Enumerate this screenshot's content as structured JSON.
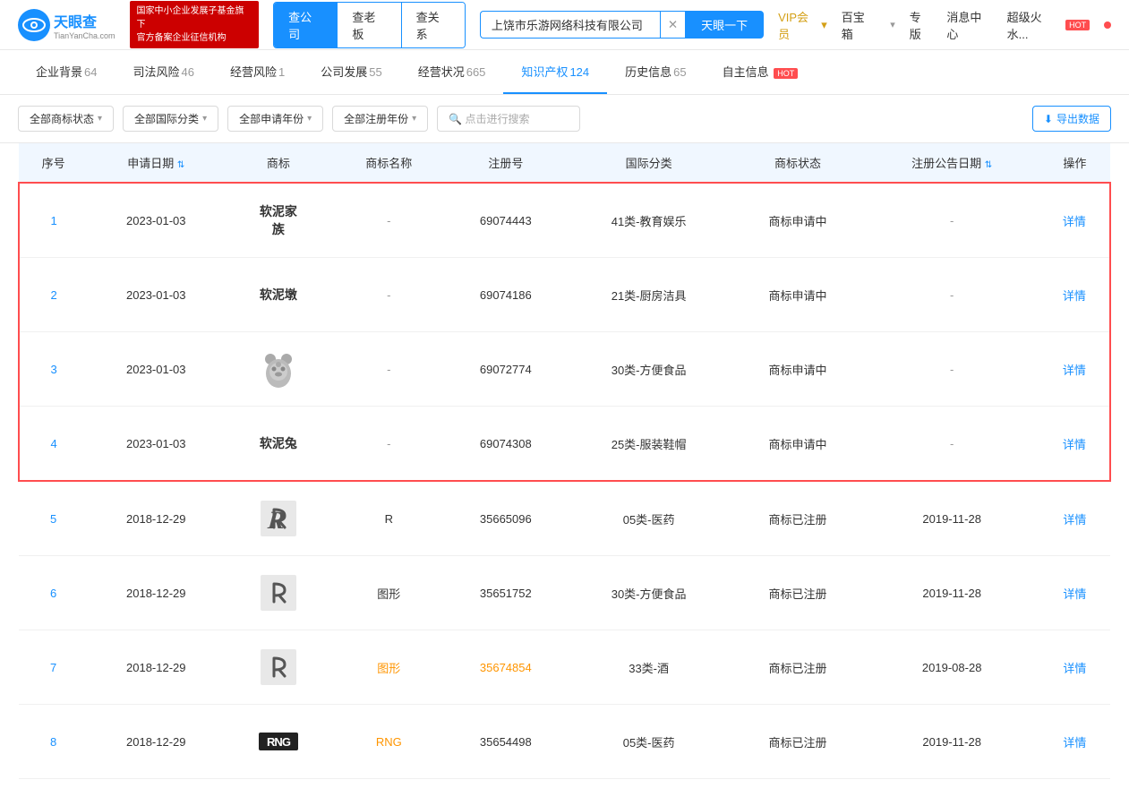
{
  "header": {
    "logo_text": "天眼查",
    "logo_sub": "TianYanCha.com",
    "official_badge": "国家中小企业发展子基金旗下\n官方备案企业征信机构",
    "tabs": [
      {
        "label": "查公司",
        "active": true
      },
      {
        "label": "查老板",
        "active": false
      },
      {
        "label": "查关系",
        "active": false
      }
    ],
    "search_value": "上饶市乐游网络科技有限公司",
    "search_btn": "天眼一下",
    "vip_label": "VIP会员",
    "baibao": "百宝箱",
    "pro": "专版",
    "msg": "消息中心",
    "hot_label": "超级火水...",
    "hot_badge": "HOT"
  },
  "nav": {
    "tabs": [
      {
        "label": "企业背景",
        "count": "64",
        "active": false
      },
      {
        "label": "司法风险",
        "count": "46",
        "active": false
      },
      {
        "label": "经营风险",
        "count": "1",
        "active": false
      },
      {
        "label": "公司发展",
        "count": "55",
        "active": false
      },
      {
        "label": "经营状况",
        "count": "665",
        "active": false
      },
      {
        "label": "知识产权",
        "count": "124",
        "active": true
      },
      {
        "label": "历史信息",
        "count": "65",
        "active": false
      },
      {
        "label": "自主信息",
        "count": "",
        "hot": true,
        "active": false
      }
    ]
  },
  "filters": {
    "status": "全部商标状态",
    "intl_class": "全部国际分类",
    "apply_year": "全部申请年份",
    "reg_year": "全部注册年份",
    "search_placeholder": "点击进行搜索",
    "export": "导出数据"
  },
  "table": {
    "columns": [
      "序号",
      "申请日期",
      "商标",
      "商标名称",
      "注册号",
      "国际分类",
      "商标状态",
      "注册公告日期",
      "操作"
    ],
    "rows": [
      {
        "id": 1,
        "date": "2023-01-03",
        "trademark_type": "text",
        "trademark_text": "软泥家族",
        "trademark_name": "-",
        "reg_num": "69074443",
        "intl_class": "41类-教育娱乐",
        "status": "商标申请中",
        "pub_date": "-",
        "detail": "详情",
        "highlighted": true
      },
      {
        "id": 2,
        "date": "2023-01-03",
        "trademark_type": "text",
        "trademark_text": "软泥墩",
        "trademark_name": "-",
        "reg_num": "69074186",
        "intl_class": "21类-厨房洁具",
        "status": "商标申请中",
        "pub_date": "-",
        "detail": "详情",
        "highlighted": true
      },
      {
        "id": 3,
        "date": "2023-01-03",
        "trademark_type": "bear_image",
        "trademark_text": "",
        "trademark_name": "-",
        "reg_num": "69072774",
        "intl_class": "30类-方便食品",
        "status": "商标申请中",
        "pub_date": "-",
        "detail": "详情",
        "highlighted": true
      },
      {
        "id": 4,
        "date": "2023-01-03",
        "trademark_type": "text",
        "trademark_text": "软泥兔",
        "trademark_name": "-",
        "reg_num": "69074308",
        "intl_class": "25类-服装鞋帽",
        "status": "商标申请中",
        "pub_date": "-",
        "detail": "详情",
        "highlighted": true
      },
      {
        "id": 5,
        "date": "2018-12-29",
        "trademark_type": "r_logo",
        "trademark_text": "R",
        "trademark_name": "R",
        "reg_num": "35665096",
        "intl_class": "05类-医药",
        "status": "商标已注册",
        "pub_date": "2019-11-28",
        "detail": "详情",
        "highlighted": false
      },
      {
        "id": 6,
        "date": "2018-12-29",
        "trademark_type": "r_logo",
        "trademark_text": "图形",
        "trademark_name": "图形",
        "reg_num": "35651752",
        "intl_class": "30类-方便食品",
        "status": "商标已注册",
        "pub_date": "2019-11-28",
        "detail": "详情",
        "highlighted": false
      },
      {
        "id": 7,
        "date": "2018-12-29",
        "trademark_type": "r_logo",
        "trademark_text": "图形",
        "trademark_name": "图形",
        "reg_num": "35674854",
        "intl_class": "33类-酒",
        "status": "商标已注册",
        "pub_date": "2019-08-28",
        "detail": "详情",
        "highlighted": false
      },
      {
        "id": 8,
        "date": "2018-12-29",
        "trademark_type": "rng_logo",
        "trademark_text": "RNG",
        "trademark_name": "RNG",
        "reg_num": "35654498",
        "intl_class": "05类-医药",
        "status": "商标已注册",
        "pub_date": "2019-11-28",
        "detail": "详情",
        "highlighted": false
      }
    ],
    "detail_label": "详情"
  },
  "colors": {
    "primary": "#1890ff",
    "danger": "#ff4d4f",
    "orange": "#ff9500",
    "gold": "#d4a017"
  }
}
